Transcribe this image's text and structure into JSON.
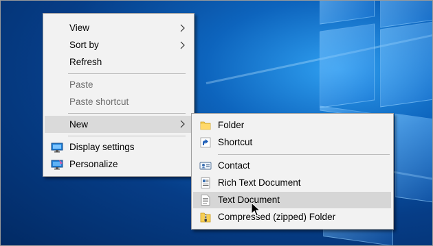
{
  "context_menu": {
    "items": [
      {
        "label": "View",
        "has_submenu": true
      },
      {
        "label": "Sort by",
        "has_submenu": true
      },
      {
        "label": "Refresh"
      },
      {
        "label": "Paste",
        "disabled": true
      },
      {
        "label": "Paste shortcut",
        "disabled": true
      },
      {
        "label": "New",
        "has_submenu": true,
        "highlighted": true
      },
      {
        "label": "Display settings",
        "icon": "display-settings-icon"
      },
      {
        "label": "Personalize",
        "icon": "personalize-icon"
      }
    ]
  },
  "new_submenu": {
    "items": [
      {
        "label": "Folder",
        "icon": "folder-icon"
      },
      {
        "label": "Shortcut",
        "icon": "shortcut-icon"
      },
      {
        "label": "Contact",
        "icon": "contact-icon"
      },
      {
        "label": "Rich Text Document",
        "icon": "rich-text-document-icon"
      },
      {
        "label": "Text Document",
        "icon": "text-document-icon",
        "highlighted": true
      },
      {
        "label": "Compressed (zipped) Folder",
        "icon": "zip-folder-icon"
      }
    ]
  },
  "colors": {
    "menu_background": "#f2f2f2",
    "highlight": "#dadada",
    "disabled_text": "#6d6d6d",
    "desktop_blue": "#0d64bd"
  }
}
